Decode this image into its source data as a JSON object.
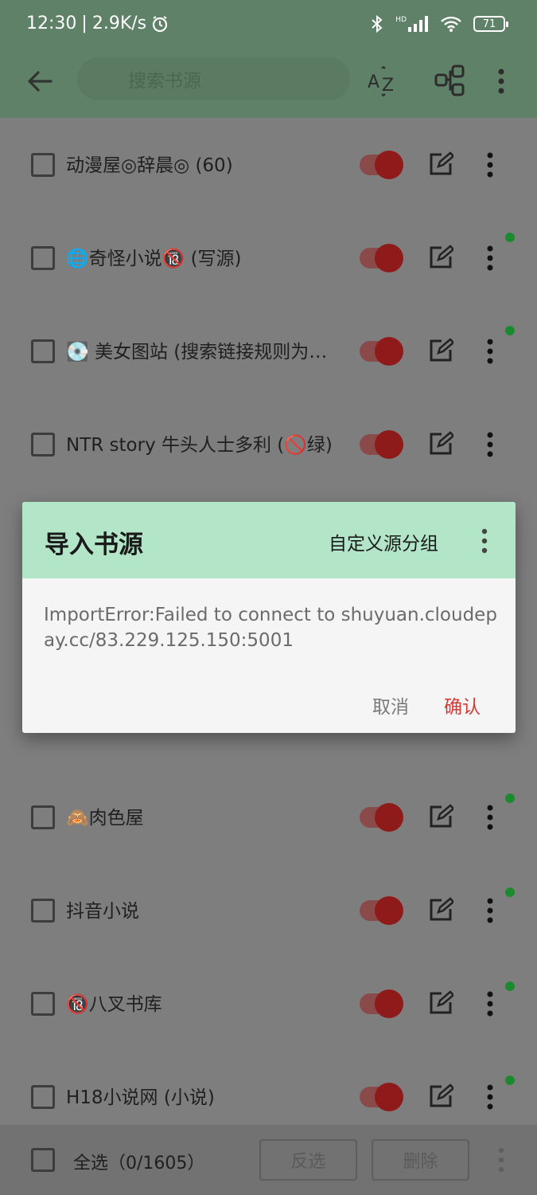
{
  "status_bar": {
    "time": "12:30",
    "network_speed": "2.9K/s",
    "network_type": "HD",
    "battery": "71"
  },
  "toolbar": {
    "search_placeholder": "搜索书源",
    "sort_icon": "az-sort-icon",
    "group_icon": "group-icon"
  },
  "sources": [
    {
      "name": "动漫屋◎辞晨◎ (60)",
      "enabled": true,
      "has_dot": false
    },
    {
      "name": "🌐奇怪小说🔞 (写源)",
      "enabled": true,
      "has_dot": true
    },
    {
      "name": "💽 美女图站 (搜索链接规则为…",
      "enabled": true,
      "has_dot": true
    },
    {
      "name": "NTR story 牛头人士多利 (🚫绿)",
      "enabled": true,
      "has_dot": false
    },
    {
      "name": "",
      "enabled": true,
      "has_dot": false
    },
    {
      "name": "",
      "enabled": true,
      "has_dot": false
    },
    {
      "name": "🙈肉色屋",
      "enabled": true,
      "has_dot": true
    },
    {
      "name": "抖音小说",
      "enabled": true,
      "has_dot": true
    },
    {
      "name": "🔞八叉书库",
      "enabled": true,
      "has_dot": true
    },
    {
      "name": "H18小说网 (小说)",
      "enabled": true,
      "has_dot": true
    }
  ],
  "bottom_bar": {
    "select_all": "全选（0/1605）",
    "invert_label": "反选",
    "delete_label": "删除"
  },
  "dialog": {
    "title": "导入书源",
    "group_label": "自定义源分组",
    "message": "ImportError:Failed to connect to shuyuan.cloudepay.cc/83.229.125.150:5001",
    "cancel_label": "取消",
    "confirm_label": "确认"
  },
  "colors": {
    "header_green": "#5f8168",
    "dialog_header": "#b3e6c8",
    "accent_red": "#d43a33",
    "toggle_red": "#8f1a1a",
    "dot_green": "#1b8a2f"
  }
}
